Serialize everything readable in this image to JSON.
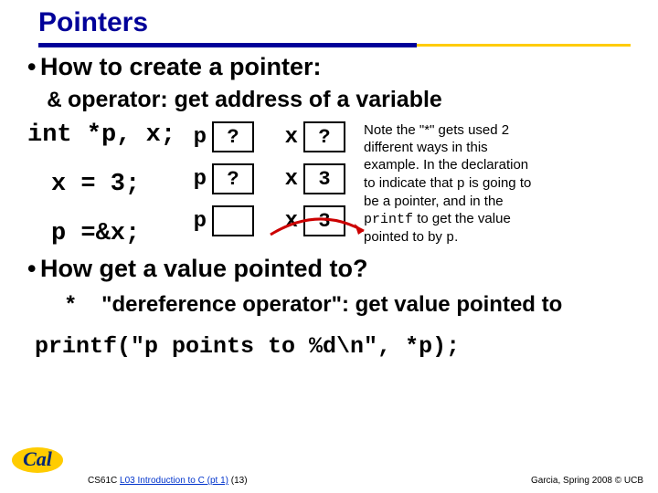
{
  "title": "Pointers",
  "bullet_create": "How to create a pointer:",
  "amp": "&",
  "amp_text": "operator: get address of a variable",
  "code": {
    "line1": "int *p, x;",
    "line2": "x = 3;",
    "line3": "p =&x;"
  },
  "rows": [
    {
      "p": "p",
      "pval": "?",
      "x": "x",
      "xval": "?"
    },
    {
      "p": "p",
      "pval": "?",
      "x": "x",
      "xval": "3"
    },
    {
      "p": "p",
      "pval": "",
      "x": "x",
      "xval": "3"
    }
  ],
  "note_parts": {
    "a": "Note the \"*\" gets used 2 different ways in this example.  In the declaration to indicate that ",
    "b": "p",
    "c": " is going to be a pointer,  and in the ",
    "d": "printf",
    "e": " to get the value pointed to by ",
    "f": "p",
    "g": "."
  },
  "bullet_get": "How get a value pointed to?",
  "star": "*",
  "deref_text": "\"dereference operator\": get value pointed to",
  "printf_line": "printf(\"p points to %d\\n\", *p);",
  "footer": {
    "course": "CS61C",
    "lecture": "L03 Introduction to C (pt 1)",
    "page": "(13)",
    "right": "Garcia, Spring 2008 © UCB"
  }
}
